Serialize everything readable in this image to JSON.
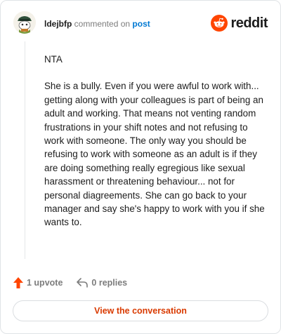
{
  "header": {
    "username": "ldejbfp",
    "commented_text": "commented on",
    "post_link": "post",
    "brand": "reddit"
  },
  "comment": {
    "paragraphs": [
      "NTA",
      "She is a bully. Even if you were awful to work with... getting along with your colleagues is part of being an adult and working. That means not venting random frustrations in your shift notes and not refusing to work with someone. The only way you should be refusing to work with someone as an adult is if they are doing something really egregious like sexual harassment or threatening behaviour... not for personal diagreements. She can go back to your manager and say she's happy to work with you if she wants to."
    ]
  },
  "actions": {
    "upvotes": "1 upvote",
    "replies": "0 replies"
  },
  "cta_label": "View the conversation",
  "colors": {
    "accent": "#ff4500",
    "link": "#0079d3",
    "cta_text": "#d93a00"
  },
  "icons": {
    "avatar": "snoo-avatar",
    "brand": "reddit-snoo-icon",
    "upvote": "upvote-arrow-icon",
    "reply": "reply-arrow-icon"
  }
}
